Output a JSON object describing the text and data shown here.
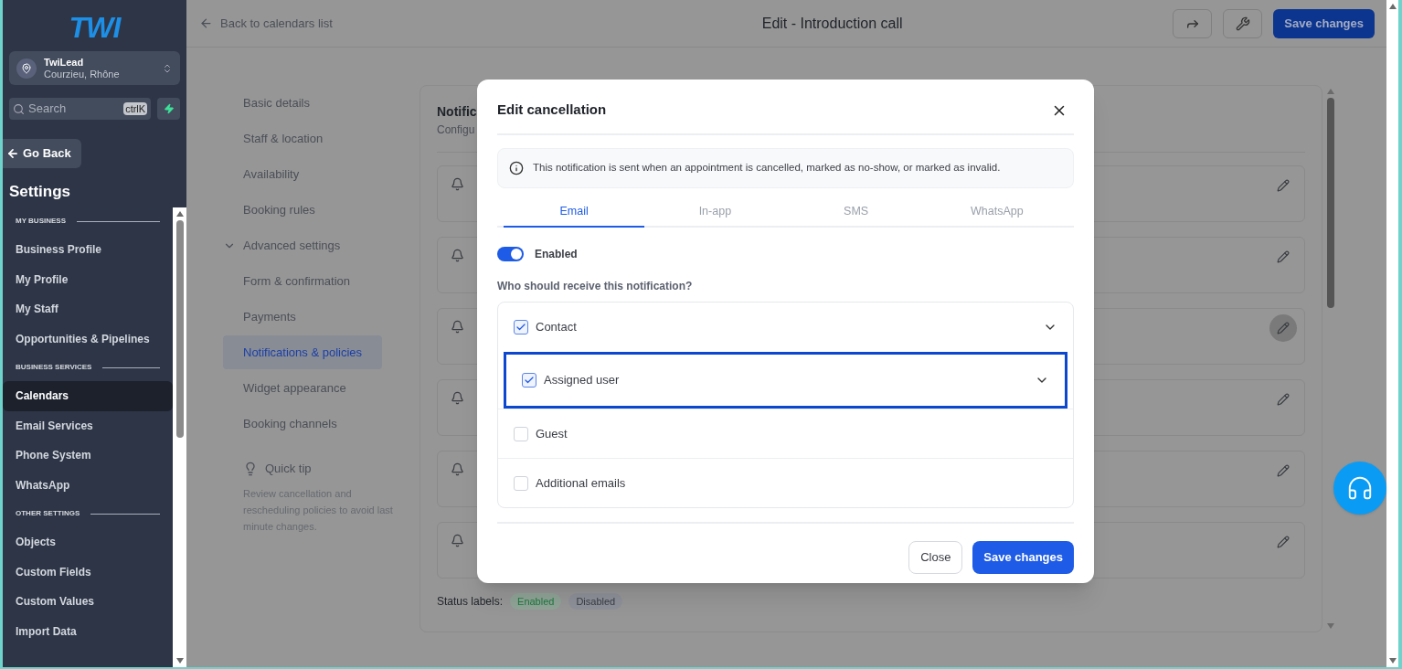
{
  "sidebar": {
    "logo": "TWI",
    "account": {
      "name": "TwiLead",
      "location": "Courzieu, Rhône"
    },
    "search": {
      "placeholder": "Search",
      "shortcut": "ctrlK"
    },
    "back_button": "Go Back",
    "heading": "Settings",
    "sections": [
      {
        "title": "MY BUSINESS",
        "items": [
          {
            "label": "Business Profile",
            "selected": false
          },
          {
            "label": "My Profile",
            "selected": false
          },
          {
            "label": "My Staff",
            "selected": false
          },
          {
            "label": "Opportunities & Pipelines",
            "selected": false
          }
        ]
      },
      {
        "title": "BUSINESS SERVICES",
        "items": [
          {
            "label": "Calendars",
            "selected": true
          },
          {
            "label": "Email Services",
            "selected": false
          },
          {
            "label": "Phone System",
            "selected": false
          },
          {
            "label": "WhatsApp",
            "selected": false
          }
        ]
      },
      {
        "title": "OTHER SETTINGS",
        "items": [
          {
            "label": "Objects",
            "selected": false
          },
          {
            "label": "Custom Fields",
            "selected": false
          },
          {
            "label": "Custom Values",
            "selected": false
          },
          {
            "label": "Import Data",
            "selected": false
          }
        ]
      }
    ]
  },
  "header": {
    "back_link": "Back to calendars list",
    "title": "Edit - Introduction call",
    "save_button": "Save changes"
  },
  "nav": {
    "items": [
      {
        "label": "Basic details",
        "kind": "link",
        "selected": false
      },
      {
        "label": "Staff & location",
        "kind": "link",
        "selected": false
      },
      {
        "label": "Availability",
        "kind": "link",
        "selected": false
      },
      {
        "label": "Booking rules",
        "kind": "link",
        "selected": false
      },
      {
        "label": "Advanced settings",
        "kind": "group",
        "expanded": true,
        "children": [
          {
            "label": "Form & confirmation",
            "selected": false
          },
          {
            "label": "Payments",
            "selected": false
          },
          {
            "label": "Notifications & policies",
            "selected": true
          },
          {
            "label": "Widget appearance",
            "selected": false
          },
          {
            "label": "Booking channels",
            "selected": false
          }
        ]
      }
    ],
    "quick_tip": {
      "title": "Quick tip",
      "text": "Review cancellation and rescheduling policies to avoid last minute changes."
    }
  },
  "panel": {
    "title": "Notific",
    "subtitle": "Configu",
    "cards": [
      {
        "hovered": false
      },
      {
        "hovered": false
      },
      {
        "hovered": true
      },
      {
        "hovered": false
      },
      {
        "hovered": false
      },
      {
        "hovered": false
      }
    ],
    "status_labels": {
      "label": "Status labels:",
      "badges": [
        {
          "text": "Enabled",
          "kind": "enabled"
        },
        {
          "text": "Disabled",
          "kind": "disabled"
        }
      ]
    }
  },
  "modal": {
    "title": "Edit cancellation",
    "info": "This notification is sent when an appointment is cancelled, marked as no-show, or marked as invalid.",
    "tabs": [
      {
        "label": "Email",
        "selected": true
      },
      {
        "label": "In-app",
        "selected": false
      },
      {
        "label": "SMS",
        "selected": false
      },
      {
        "label": "WhatsApp",
        "selected": false
      }
    ],
    "toggle": {
      "label": "Enabled",
      "on": true
    },
    "question": "Who should receive this notification?",
    "recipients": [
      {
        "label": "Contact",
        "checked": true,
        "expandable": true,
        "focused": false
      },
      {
        "label": "Assigned user",
        "checked": true,
        "expandable": true,
        "focused": true
      },
      {
        "label": "Guest",
        "checked": false,
        "expandable": false,
        "focused": false
      },
      {
        "label": "Additional emails",
        "checked": false,
        "expandable": false,
        "focused": false
      }
    ],
    "close_button": "Close",
    "save_button": "Save changes"
  }
}
